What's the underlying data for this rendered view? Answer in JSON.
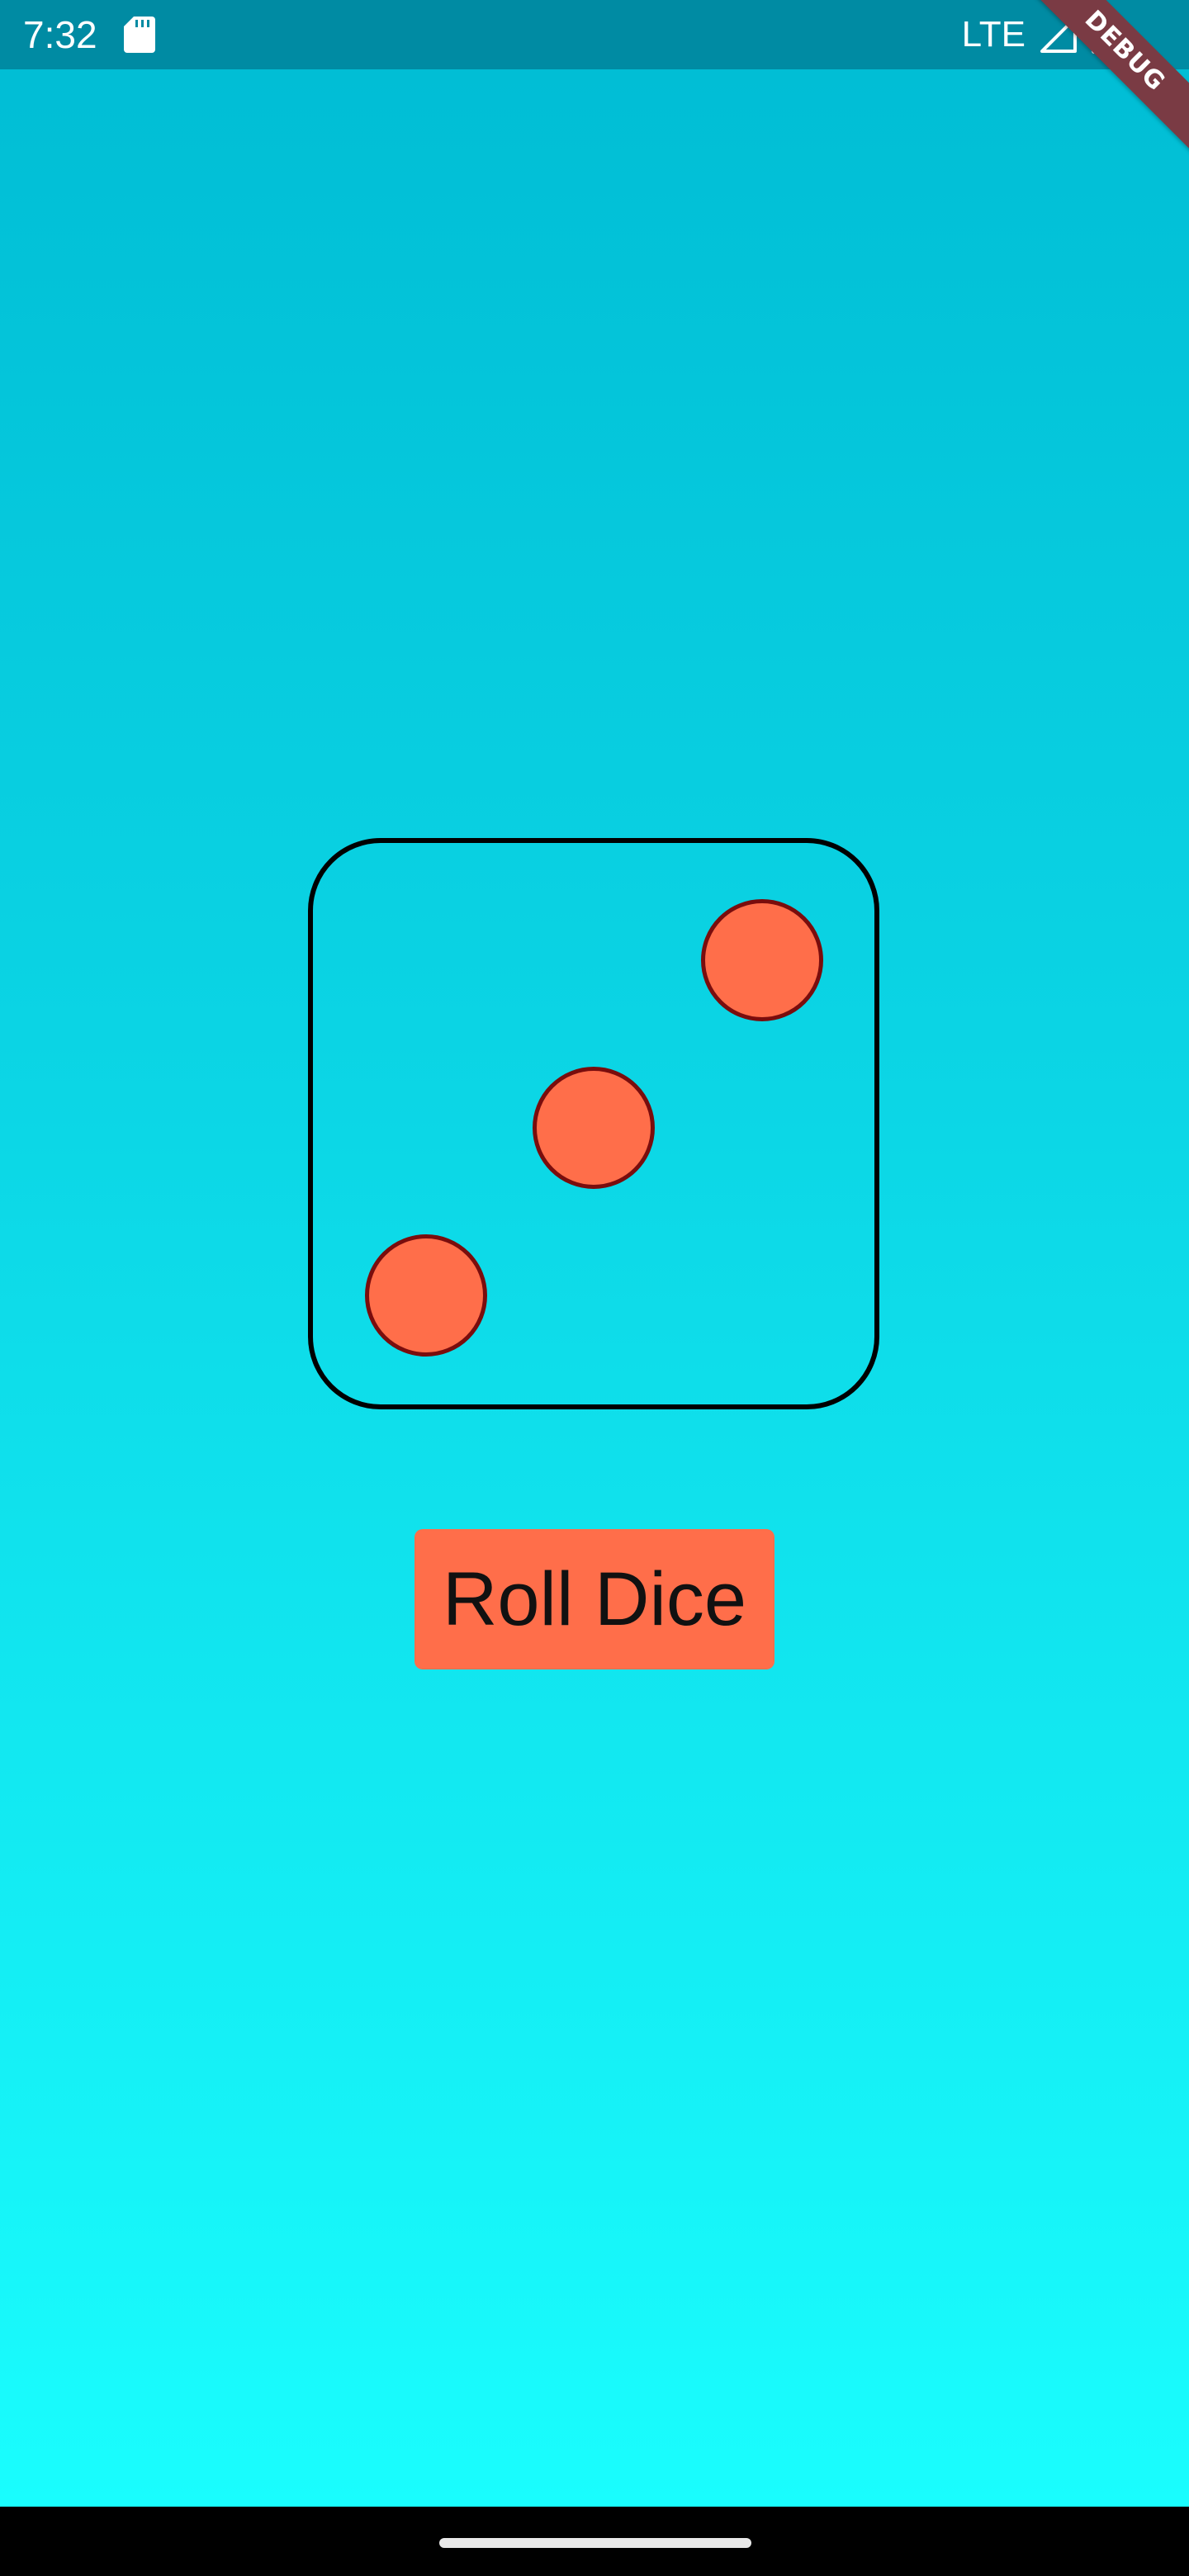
{
  "status_bar": {
    "time": "7:32",
    "network": "LTE",
    "icons": [
      "sd-card-icon",
      "signal-icon",
      "battery-icon"
    ]
  },
  "debug_banner": {
    "label": "DEBUG",
    "color": "#7a3b44"
  },
  "dice": {
    "value": 3,
    "pip_color": "#ff6e4a",
    "pip_border_color": "#7a0d0d"
  },
  "roll_button": {
    "label": "Roll Dice",
    "color": "#ff6e4a"
  },
  "colors": {
    "gradient_top": "#00bcd4",
    "gradient_bottom": "#1affff",
    "status_bar": "#008ba3"
  }
}
